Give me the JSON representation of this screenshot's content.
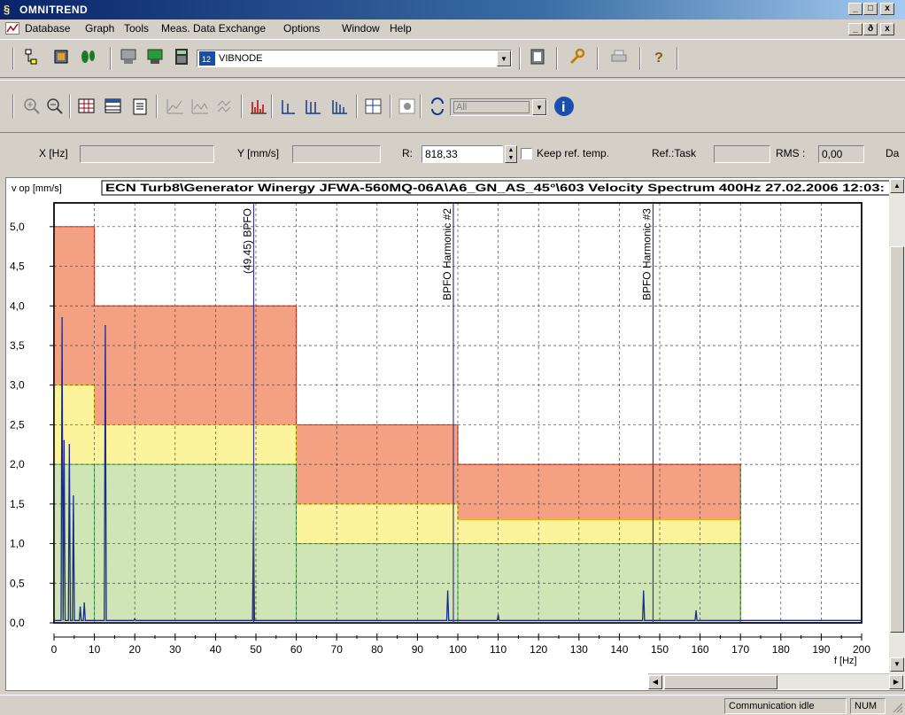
{
  "window": {
    "title": "OMNITREND",
    "min": "_",
    "restore": "□",
    "close": "x",
    "child_min": "_",
    "child_restore": "ð",
    "child_close": "x"
  },
  "menu": [
    {
      "label": "Database"
    },
    {
      "label": "Graph"
    },
    {
      "label": "Tools"
    },
    {
      "label": "Meas. Data Exchange"
    },
    {
      "label": "Options"
    },
    {
      "label": "Window"
    },
    {
      "label": "Help"
    }
  ],
  "toolbar1": {
    "node_combo_value": "VIBNODE",
    "icons": [
      "tree-icon",
      "database-icon",
      "footprint-icon",
      "device-gray-icon",
      "device-green-icon",
      "calculator-icon",
      "clipboard-icon",
      "wrench-icon",
      "printer-icon",
      "help-question-icon"
    ]
  },
  "toolbar2": {
    "filter_combo_value": "All",
    "icons": [
      "zoom-in-icon",
      "zoom-out-icon",
      "grid-icon",
      "table-icon",
      "report-icon",
      "trend-icon",
      "waterfall-icon",
      "compare-icon",
      "spectrum-icon",
      "harmonic-1-icon",
      "harmonic-2-icon",
      "harmonic-3-icon",
      "layout-icon",
      "settings-icon",
      "refresh-icon",
      "info-icon"
    ]
  },
  "readouts": {
    "x_label": "X [Hz]",
    "x_value": "",
    "y_label": "Y [mm/s]",
    "y_value": "",
    "r_label": "R:",
    "r_value": "818,33",
    "keep_ref_label": "Keep ref. temp.",
    "ref_task_label": "Ref.:Task",
    "ref_task_value": "",
    "rms_label": "RMS :",
    "rms_value": "0,00",
    "trailing_label": "Da"
  },
  "chart_header": {
    "y_unit": "v op [mm/s]",
    "path": "ECN Turb8\\Generator Winergy JFWA-560MQ-06A\\A6_GN_AS_45°\\603 Velocity Spectrum 400Hz 27.02.2006 12:03:"
  },
  "chart_data": {
    "type": "line",
    "xlabel": "f [Hz]",
    "ylabel": "v op [mm/s]",
    "xlim": [
      0,
      200
    ],
    "ylim": [
      0,
      5.3
    ],
    "x_ticks": [
      0,
      10,
      20,
      30,
      40,
      50,
      60,
      70,
      80,
      90,
      100,
      110,
      120,
      130,
      140,
      150,
      160,
      170,
      180,
      190,
      200
    ],
    "y_ticks": [
      "0,0",
      "0,5",
      "1,0",
      "1,5",
      "2,0",
      "2,5",
      "3,0",
      "3,5",
      "4,0",
      "4,5",
      "5,0"
    ],
    "grid": true,
    "alarm_bands": [
      {
        "x0": 0,
        "x1": 10,
        "green": 2.0,
        "yellow": 3.0,
        "red": 5.0
      },
      {
        "x0": 10,
        "x1": 60,
        "green": 2.0,
        "yellow": 2.5,
        "red": 4.0
      },
      {
        "x0": 60,
        "x1": 100,
        "green": 1.0,
        "yellow": 1.5,
        "red": 2.5
      },
      {
        "x0": 100,
        "x1": 170,
        "green": 1.0,
        "yellow": 1.3,
        "red": 2.0
      }
    ],
    "markers": [
      {
        "x": 49.45,
        "label": "(49,45) BPFO"
      },
      {
        "x": 98.9,
        "label": "BPFO Harmonic #2"
      },
      {
        "x": 148.35,
        "label": "BPFO Harmonic #3"
      }
    ],
    "peaks": [
      {
        "x": 2.0,
        "y": 3.85
      },
      {
        "x": 2.5,
        "y": 2.3
      },
      {
        "x": 3.8,
        "y": 2.25
      },
      {
        "x": 4.8,
        "y": 1.6
      },
      {
        "x": 6.5,
        "y": 0.2
      },
      {
        "x": 7.5,
        "y": 0.25
      },
      {
        "x": 12.7,
        "y": 3.75
      },
      {
        "x": 20,
        "y": 0.05
      },
      {
        "x": 49.4,
        "y": 1.28
      },
      {
        "x": 97.5,
        "y": 0.4
      },
      {
        "x": 110,
        "y": 0.1
      },
      {
        "x": 146,
        "y": 0.4
      },
      {
        "x": 159,
        "y": 0.15
      }
    ],
    "colors": {
      "red_band": "#f4a183",
      "yellow_band": "#fbf49c",
      "green_band": "#cfe5b6",
      "band_edge_red": "#e0402a",
      "band_edge_green": "#4caf50",
      "trace": "#1b2a8c",
      "marker": "#3a3a8a"
    }
  },
  "status": {
    "message": "Communication idle",
    "num": "NUM"
  }
}
